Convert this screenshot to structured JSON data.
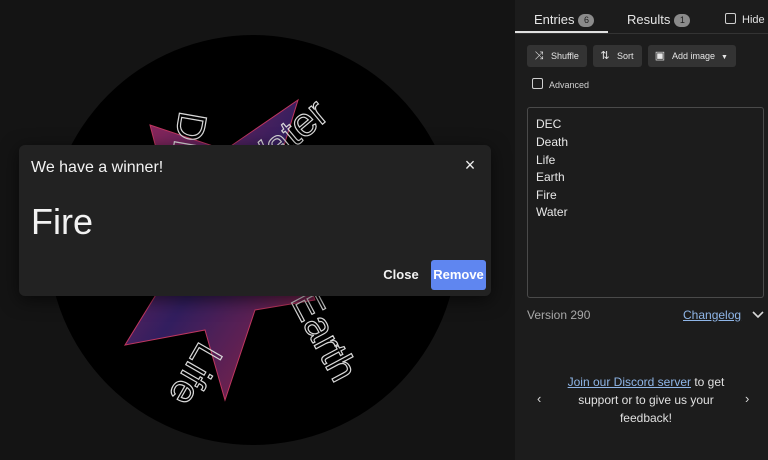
{
  "wheel": {
    "labels": [
      "DEC",
      "Water",
      "Earth",
      "Life"
    ]
  },
  "dialog": {
    "title": "We have a winner!",
    "close_icon": "×",
    "winner": "Fire",
    "close_label": "Close",
    "remove_label": "Remove"
  },
  "tabs": {
    "entries_label": "Entries",
    "entries_count": "6",
    "results_label": "Results",
    "results_count": "1",
    "hide_label": "Hide"
  },
  "toolbar": {
    "shuffle_label": "Shuffle",
    "sort_label": "Sort",
    "add_image_label": "Add image",
    "advanced_label": "Advanced"
  },
  "entries": [
    "DEC",
    "Death",
    "Life",
    "Earth",
    "Fire",
    "Water"
  ],
  "footer": {
    "version": "Version 290",
    "changelog": "Changelog"
  },
  "promo": {
    "link_text": "Join our Discord server",
    "rest_text": " to get support or to give us your feedback!"
  },
  "colors": {
    "accent": "#5f86f0",
    "link": "#8fb6e8",
    "panel_bg": "#1c1c1c",
    "page_bg": "#141414"
  }
}
